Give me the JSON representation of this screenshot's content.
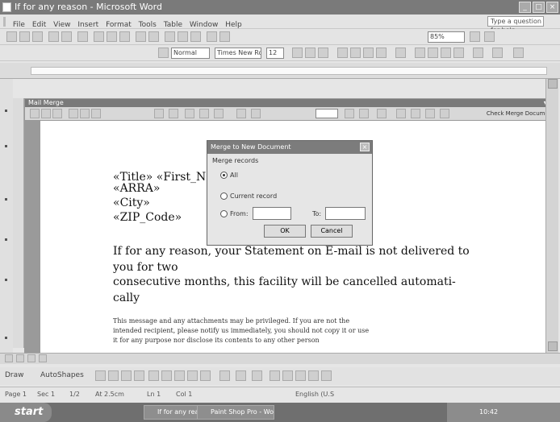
{
  "window": {
    "title": "If for any reason - Microsoft Word"
  },
  "menu": {
    "items": [
      "File",
      "Edit",
      "View",
      "Insert",
      "Format",
      "Tools",
      "Table",
      "Window",
      "Help"
    ],
    "help_placeholder": "Type a question for help"
  },
  "toolbar": {
    "zoom": "85%",
    "style": "Times New Roman",
    "size": "12"
  },
  "mail_merge": {
    "title": "Mail Merge",
    "check_errors": "Check Merge Document"
  },
  "dialog": {
    "title": "Merge to New Document",
    "merge_records": "Merge records",
    "all": "All",
    "current": "Current record",
    "from": "From:",
    "to": "To:",
    "ok": "OK",
    "cancel": "Cancel",
    "selected": "All"
  },
  "document": {
    "line1": "«Title» «First_N",
    "line2": "«ARRA»",
    "line3": "«City»",
    "line4": "«ZIP_Code»",
    "para1": "If for any reason, your Statement on E-mail is not delivered to",
    "para2": "you for two",
    "para3": "consecutive months, this facility will be cancelled automati-",
    "para4": "cally",
    "small1": "This message and any attachments may be privileged. If you are not the",
    "small2": "intended recipient, please notify us immediately, you should not copy it or use",
    "small3": "it for any purpose nor disclose its contents to any other person"
  },
  "drawbar": {
    "draw": "Draw",
    "autoshapes": "AutoShapes"
  },
  "status": {
    "page": "Page 1",
    "sec": "Sec 1",
    "pos": "1/2",
    "at": "At 2.5cm",
    "ln": "Ln 1",
    "col": "Col 1",
    "lang": "English (U.S"
  },
  "taskbar": {
    "start": "start",
    "task1": "If for any reason - W...",
    "task2": "Paint Shop Pro - Wor...",
    "clock": "10:42"
  }
}
